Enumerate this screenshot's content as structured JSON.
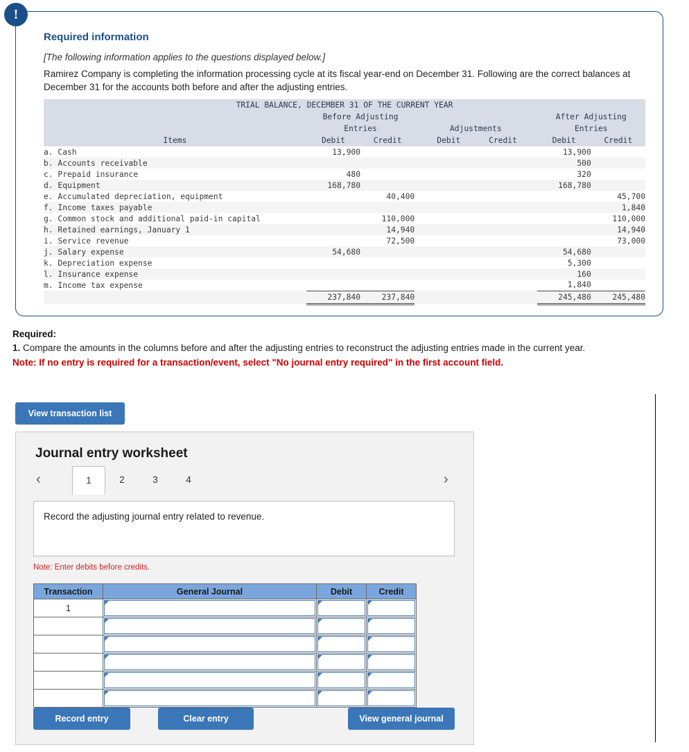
{
  "alert": {
    "icon": "exclamation-icon",
    "glyph": "!"
  },
  "required_information": {
    "title": "Required information",
    "italic_note": "[The following information applies to the questions displayed below.]",
    "body": "Ramirez Company is completing the information processing cycle at its fiscal year-end on December 31. Following are the correct balances at December 31 for the accounts both before and after the adjusting entries."
  },
  "trial_balance": {
    "title": "TRIAL BALANCE, DECEMBER 31 OF THE CURRENT YEAR",
    "group_headers": {
      "before_line1": "Before Adjusting",
      "before_line2": "Entries",
      "adjustments": "Adjustments",
      "after_line1": "After Adjusting",
      "after_line2": "Entries"
    },
    "columns": {
      "items": "Items",
      "before_debit": "Debit",
      "before_credit": "Credit",
      "adj_debit": "Debit",
      "adj_credit": "Credit",
      "after_debit": "Debit",
      "after_credit": "Credit"
    },
    "rows": [
      {
        "item": "a. Cash",
        "bd": "13,900",
        "bc": "",
        "ad": "",
        "ac": "",
        "fd": "13,900",
        "fc": ""
      },
      {
        "item": "b. Accounts receivable",
        "bd": "",
        "bc": "",
        "ad": "",
        "ac": "",
        "fd": "500",
        "fc": ""
      },
      {
        "item": "c. Prepaid insurance",
        "bd": "480",
        "bc": "",
        "ad": "",
        "ac": "",
        "fd": "320",
        "fc": ""
      },
      {
        "item": "d. Equipment",
        "bd": "168,780",
        "bc": "",
        "ad": "",
        "ac": "",
        "fd": "168,780",
        "fc": ""
      },
      {
        "item": "e. Accumulated depreciation, equipment",
        "bd": "",
        "bc": "40,400",
        "ad": "",
        "ac": "",
        "fd": "",
        "fc": "45,700"
      },
      {
        "item": "f. Income taxes payable",
        "bd": "",
        "bc": "",
        "ad": "",
        "ac": "",
        "fd": "",
        "fc": "1,840"
      },
      {
        "item": "g. Common stock and additional paid-in capital",
        "bd": "",
        "bc": "110,000",
        "ad": "",
        "ac": "",
        "fd": "",
        "fc": "110,000"
      },
      {
        "item": "h. Retained earnings, January 1",
        "bd": "",
        "bc": "14,940",
        "ad": "",
        "ac": "",
        "fd": "",
        "fc": "14,940"
      },
      {
        "item": "i. Service revenue",
        "bd": "",
        "bc": "72,500",
        "ad": "",
        "ac": "",
        "fd": "",
        "fc": "73,000"
      },
      {
        "item": "j. Salary expense",
        "bd": "54,680",
        "bc": "",
        "ad": "",
        "ac": "",
        "fd": "54,680",
        "fc": ""
      },
      {
        "item": "k. Depreciation expense",
        "bd": "",
        "bc": "",
        "ad": "",
        "ac": "",
        "fd": "5,300",
        "fc": ""
      },
      {
        "item": "l. Insurance expense",
        "bd": "",
        "bc": "",
        "ad": "",
        "ac": "",
        "fd": "160",
        "fc": ""
      },
      {
        "item": "m. Income tax expense",
        "bd": "",
        "bc": "",
        "ad": "",
        "ac": "",
        "fd": "1,840",
        "fc": ""
      }
    ],
    "totals": {
      "item": "",
      "bd": "237,840",
      "bc": "237,840",
      "ad": "",
      "ac": "",
      "fd": "245,480",
      "fc": "245,480"
    }
  },
  "required_section": {
    "label": "Required:",
    "number": "1.",
    "text": "Compare the amounts in the columns before and after the adjusting entries to reconstruct the adjusting entries made in the current year.",
    "note": "Note: If no entry is required for a transaction/event, select \"No journal entry required\" in the first account field."
  },
  "view_transaction_list_button": "View transaction list",
  "worksheet": {
    "title": "Journal entry worksheet",
    "prev_arrow": "‹",
    "next_arrow": "›",
    "tabs": [
      {
        "label": "1",
        "active": true
      },
      {
        "label": "2",
        "active": false
      },
      {
        "label": "3",
        "active": false
      },
      {
        "label": "4",
        "active": false
      }
    ],
    "instruction": "Record the adjusting journal entry related to revenue.",
    "debit_note": "Note: Enter debits before credits.",
    "table": {
      "headers": [
        "Transaction",
        "General Journal",
        "Debit",
        "Credit"
      ],
      "rows": [
        {
          "transaction": "1",
          "general_journal": "",
          "debit": "",
          "credit": ""
        },
        {
          "transaction": "",
          "general_journal": "",
          "debit": "",
          "credit": ""
        },
        {
          "transaction": "",
          "general_journal": "",
          "debit": "",
          "credit": ""
        },
        {
          "transaction": "",
          "general_journal": "",
          "debit": "",
          "credit": ""
        },
        {
          "transaction": "",
          "general_journal": "",
          "debit": "",
          "credit": ""
        },
        {
          "transaction": "",
          "general_journal": "",
          "debit": "",
          "credit": ""
        }
      ]
    },
    "buttons": {
      "record": "Record entry",
      "clear": "Clear entry",
      "view_general_journal": "View general journal"
    }
  },
  "colors": {
    "accent_blue": "#3b76b8",
    "panel_border": "#1d4f7c",
    "title_blue": "#1b4f8a",
    "note_red": "#cc0000",
    "table_header_band": "#d7dce7",
    "grid_header_blue": "#7aa6dd"
  }
}
